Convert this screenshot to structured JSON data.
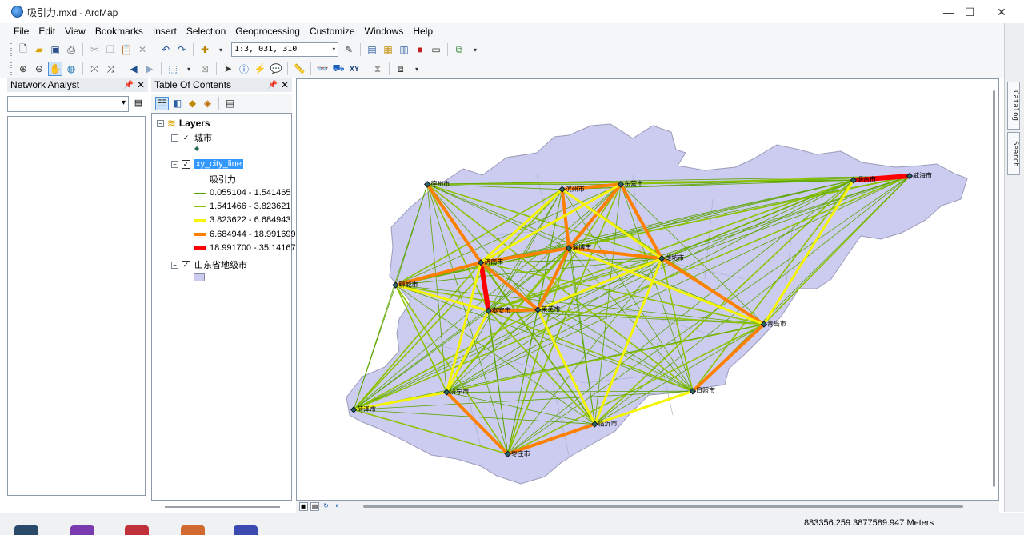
{
  "window": {
    "title": "吸引力.mxd - ArcMap"
  },
  "menu": [
    "File",
    "Edit",
    "View",
    "Bookmarks",
    "Insert",
    "Selection",
    "Geoprocessing",
    "Customize",
    "Windows",
    "Help"
  ],
  "toolbar": {
    "scale": "1:3, 031, 310"
  },
  "side_tabs": {
    "catalog": "Catalog",
    "search": "Search"
  },
  "network_analyst": {
    "title": "Network Analyst"
  },
  "toc": {
    "title": "Table Of Contents",
    "root": "Layers",
    "layers": [
      {
        "name": "城市"
      },
      {
        "name": "xy_city_line",
        "field": "吸引力",
        "classes": [
          {
            "label": "0.055104 - 1.541465",
            "color": "#5aa500",
            "width": 1
          },
          {
            "label": "1.541466 - 3.823621",
            "color": "#8cc300",
            "width": 2
          },
          {
            "label": "3.823622 - 6.684943",
            "color": "#f5f500",
            "width": 3
          },
          {
            "label": "6.684944 - 18.991699",
            "color": "#ff8000",
            "width": 4
          },
          {
            "label": "18.991700 - 35.141679",
            "color": "#ff0000",
            "width": 6
          }
        ]
      },
      {
        "name": "山东省地级市"
      }
    ]
  },
  "map": {
    "fill": "#ccccf0",
    "cities": [
      {
        "name": "德州市",
        "x": 116.36,
        "y": 37.43
      },
      {
        "name": "滨州市",
        "x": 117.97,
        "y": 37.38
      },
      {
        "name": "东营市",
        "x": 118.67,
        "y": 37.43
      },
      {
        "name": "烟台市",
        "x": 121.45,
        "y": 37.47
      },
      {
        "name": "威海市",
        "x": 122.12,
        "y": 37.51
      },
      {
        "name": "淄博市",
        "x": 118.05,
        "y": 36.81
      },
      {
        "name": "潍坊市",
        "x": 119.16,
        "y": 36.71
      },
      {
        "name": "济南市",
        "x": 117.0,
        "y": 36.67
      },
      {
        "name": "聊城市",
        "x": 115.98,
        "y": 36.45
      },
      {
        "name": "泰安市",
        "x": 117.09,
        "y": 36.2
      },
      {
        "name": "莱芜市",
        "x": 117.68,
        "y": 36.21
      },
      {
        "name": "青岛市",
        "x": 120.38,
        "y": 36.07
      },
      {
        "name": "日照市",
        "x": 119.53,
        "y": 35.42
      },
      {
        "name": "济宁市",
        "x": 116.59,
        "y": 35.41
      },
      {
        "name": "菏泽市",
        "x": 115.48,
        "y": 35.24
      },
      {
        "name": "临沂市",
        "x": 118.36,
        "y": 35.1
      },
      {
        "name": "枣庄市",
        "x": 117.32,
        "y": 34.81
      }
    ],
    "strong_links": [
      {
        "from": "烟台市",
        "to": "威海市",
        "cls": 4
      },
      {
        "from": "济南市",
        "to": "泰安市",
        "cls": 4
      },
      {
        "from": "济南市",
        "to": "淄博市",
        "cls": 3
      },
      {
        "from": "济南市",
        "to": "聊城市",
        "cls": 3
      },
      {
        "from": "济南市",
        "to": "德州市",
        "cls": 3
      },
      {
        "from": "济南市",
        "to": "莱芜市",
        "cls": 3
      },
      {
        "from": "淄博市",
        "to": "潍坊市",
        "cls": 3
      },
      {
        "from": "淄博市",
        "to": "滨州市",
        "cls": 3
      },
      {
        "from": "淄博市",
        "to": "东营市",
        "cls": 3
      },
      {
        "from": "淄博市",
        "to": "莱芜市",
        "cls": 3
      },
      {
        "from": "潍坊市",
        "to": "青岛市",
        "cls": 3
      },
      {
        "from": "潍坊市",
        "to": "东营市",
        "cls": 3
      },
      {
        "from": "滨州市",
        "to": "东营市",
        "cls": 3
      },
      {
        "from": "泰安市",
        "to": "莱芜市",
        "cls": 3
      },
      {
        "from": "济宁市",
        "to": "枣庄市",
        "cls": 3
      },
      {
        "from": "枣庄市",
        "to": "临沂市",
        "cls": 3
      },
      {
        "from": "青岛市",
        "to": "日照市",
        "cls": 3
      },
      {
        "from": "菏泽市",
        "to": "济宁市",
        "cls": 2
      },
      {
        "from": "济宁市",
        "to": "泰安市",
        "cls": 2
      },
      {
        "from": "泰安市",
        "to": "聊城市",
        "cls": 2
      },
      {
        "from": "临沂市",
        "to": "日照市",
        "cls": 2
      },
      {
        "from": "临沂市",
        "to": "莱芜市",
        "cls": 2
      },
      {
        "from": "临沂市",
        "to": "潍坊市",
        "cls": 2
      },
      {
        "from": "烟台市",
        "to": "青岛市",
        "cls": 2
      },
      {
        "from": "青岛市",
        "to": "淄博市",
        "cls": 2
      },
      {
        "from": "济南市",
        "to": "滨州市",
        "cls": 2
      },
      {
        "from": "东营市",
        "to": "济南市",
        "cls": 2
      },
      {
        "from": "莱芜市",
        "to": "潍坊市",
        "cls": 2
      },
      {
        "from": "滨州市",
        "to": "潍坊市",
        "cls": 2
      },
      {
        "from": "济南市",
        "to": "济宁市",
        "cls": 2
      }
    ]
  },
  "status": {
    "coords": "883356.259  3877589.947 Meters"
  }
}
